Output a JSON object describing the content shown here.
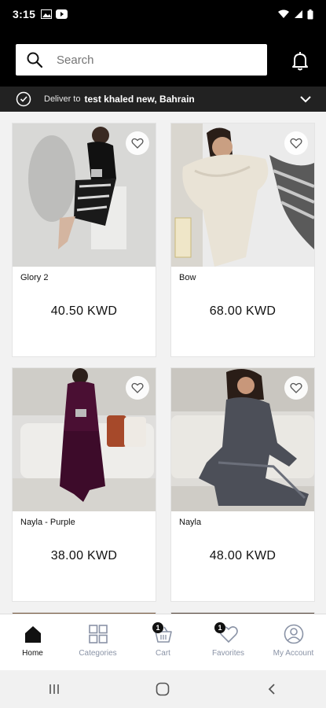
{
  "status_bar": {
    "time": "3:15"
  },
  "search": {
    "placeholder": "Search"
  },
  "delivery": {
    "label": "Deliver to",
    "address": "test khaled new, Bahrain"
  },
  "products": [
    {
      "name": "Glory 2",
      "price": "40.50 KWD"
    },
    {
      "name": "Bow",
      "price": "68.00 KWD"
    },
    {
      "name": "Nayla - Purple",
      "price": "38.00 KWD"
    },
    {
      "name": "Nayla",
      "price": "48.00 KWD"
    }
  ],
  "nav": {
    "home": "Home",
    "categories": "Categories",
    "cart": "Cart",
    "cart_badge": "1",
    "favorites": "Favorites",
    "favorites_badge": "1",
    "account": "My Account"
  },
  "colors": {
    "header_bg": "#000000",
    "deliver_bg": "#222222",
    "nav_inactive": "#8a93a6"
  }
}
